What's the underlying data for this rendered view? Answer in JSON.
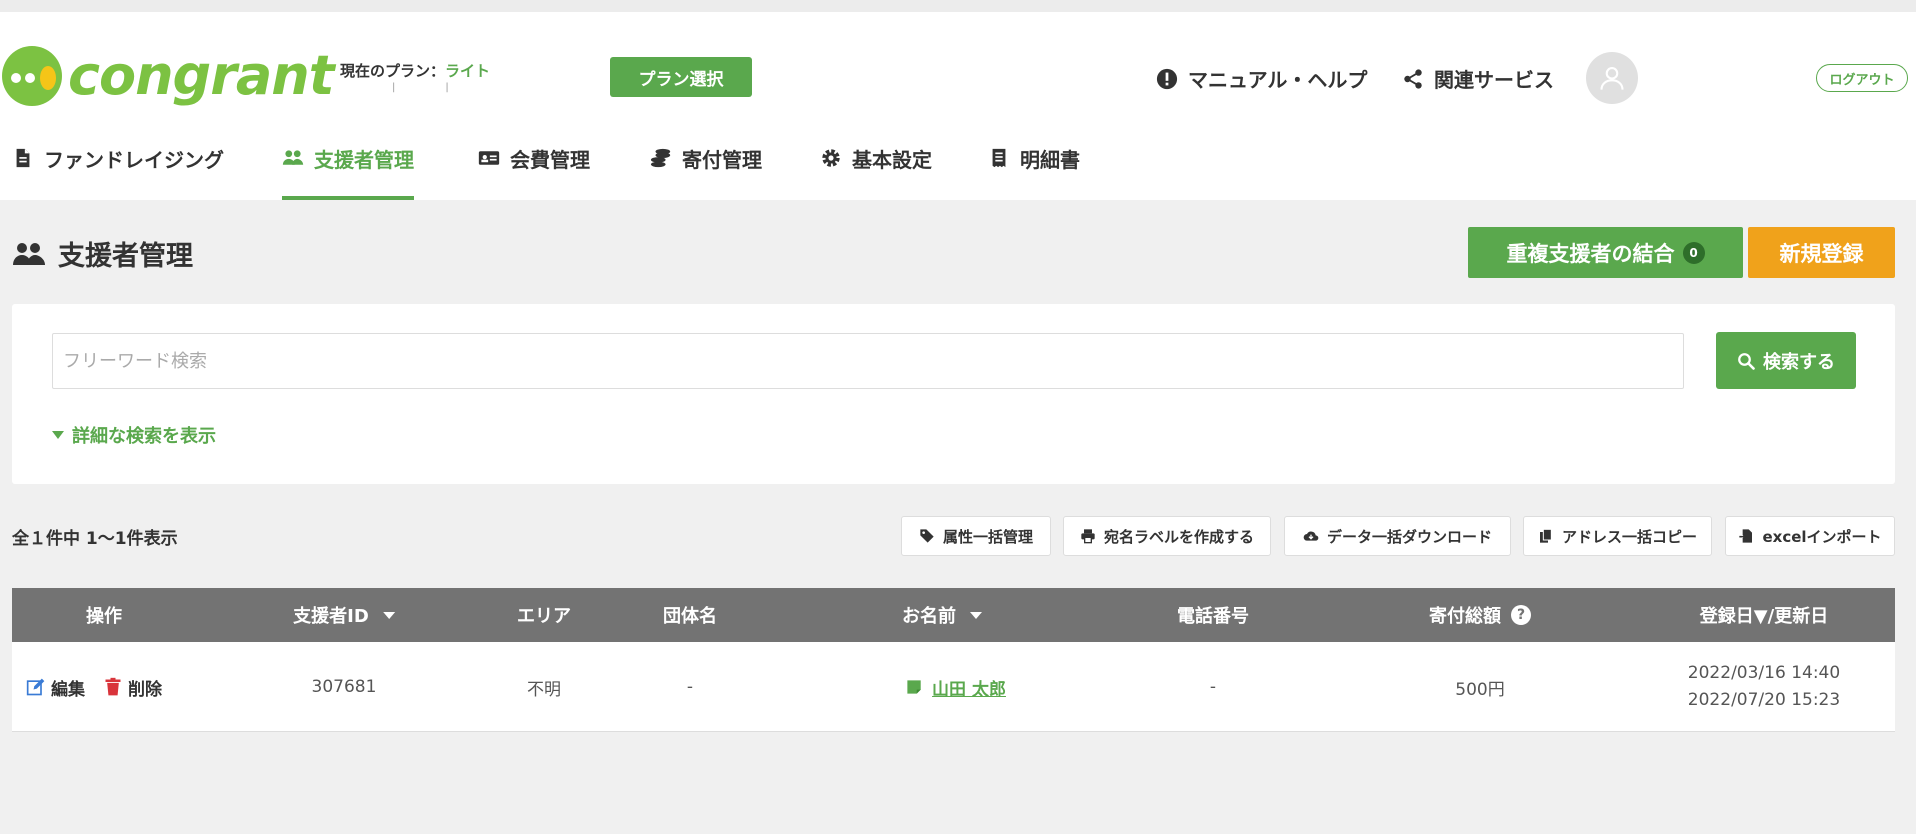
{
  "brand": {
    "logo_text": "congrant",
    "color": "#7cc242"
  },
  "header": {
    "plan_label": "現在のプラン：",
    "plan_value": "ライト",
    "plan_button": "プラン選択",
    "help_link": "マニュアル・ヘルプ",
    "services_link": "関連サービス",
    "logout": "ログアウト"
  },
  "nav": {
    "items": [
      {
        "label": "ファンドレイジング",
        "icon": "document-icon"
      },
      {
        "label": "支援者管理",
        "icon": "users-icon",
        "active": true
      },
      {
        "label": "会費管理",
        "icon": "id-card-icon"
      },
      {
        "label": "寄付管理",
        "icon": "coins-icon"
      },
      {
        "label": "基本設定",
        "icon": "gear-icon"
      },
      {
        "label": "明細書",
        "icon": "receipt-icon"
      }
    ]
  },
  "page": {
    "title": "支援者管理",
    "merge_button": "重複支援者の結合",
    "merge_count": "0",
    "new_button": "新規登録"
  },
  "search": {
    "placeholder": "フリーワード検索",
    "button": "検索する",
    "advanced_link": "詳細な検索を表示"
  },
  "results": {
    "count_text": "全１件中 1〜1件表示",
    "tools": [
      "属性一括管理",
      "宛名ラベルを作成する",
      "データ一括ダウンロード",
      "アドレス一括コピー",
      "excelインポート"
    ]
  },
  "table": {
    "headers": [
      "操作",
      "支援者ID",
      "エリア",
      "団体名",
      "お名前",
      "電話番号",
      "寄付総額",
      "登録日▼/更新日"
    ],
    "edit_label": "編集",
    "delete_label": "削除",
    "rows": [
      {
        "id": "307681",
        "area": "不明",
        "org": "-",
        "name": "山田 太郎",
        "phone": "-",
        "total": "500円",
        "registered": "2022/03/16 14:40",
        "updated": "2022/07/20 15:23"
      }
    ]
  },
  "colors": {
    "primary": "#5aa84d",
    "accent": "#f0a21b",
    "table_header": "#737373"
  }
}
